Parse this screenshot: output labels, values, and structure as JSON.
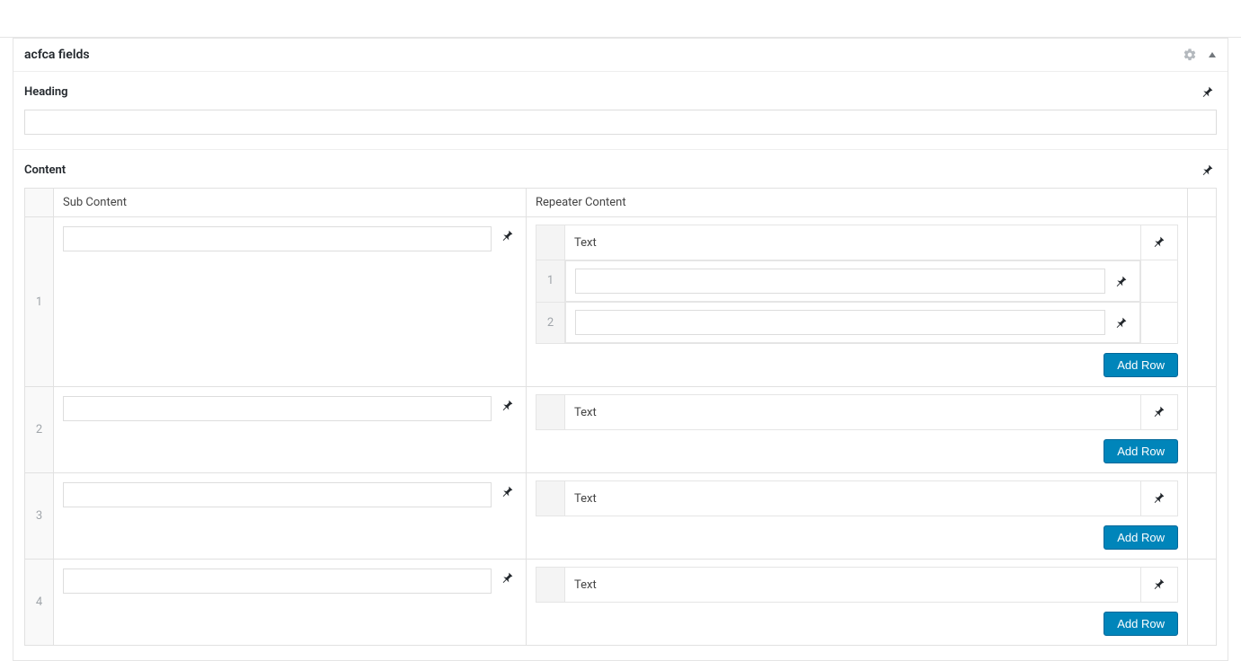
{
  "panel": {
    "title": "acfca fields"
  },
  "fields": {
    "heading": {
      "label": "Heading",
      "value": ""
    },
    "content": {
      "label": "Content",
      "columns": {
        "sub": "Sub Content",
        "repeater": "Repeater Content"
      },
      "rows": [
        {
          "num": "1",
          "sub_value": "",
          "nested": {
            "header": "Text",
            "rows": [
              {
                "num": "1",
                "value": ""
              },
              {
                "num": "2",
                "value": ""
              }
            ],
            "add_label": "Add Row"
          }
        },
        {
          "num": "2",
          "sub_value": "",
          "nested": {
            "header": "Text",
            "rows": [],
            "add_label": "Add Row"
          }
        },
        {
          "num": "3",
          "sub_value": "",
          "nested": {
            "header": "Text",
            "rows": [],
            "add_label": "Add Row"
          }
        },
        {
          "num": "4",
          "sub_value": "",
          "nested": {
            "header": "Text",
            "rows": [],
            "add_label": "Add Row"
          }
        }
      ]
    }
  }
}
